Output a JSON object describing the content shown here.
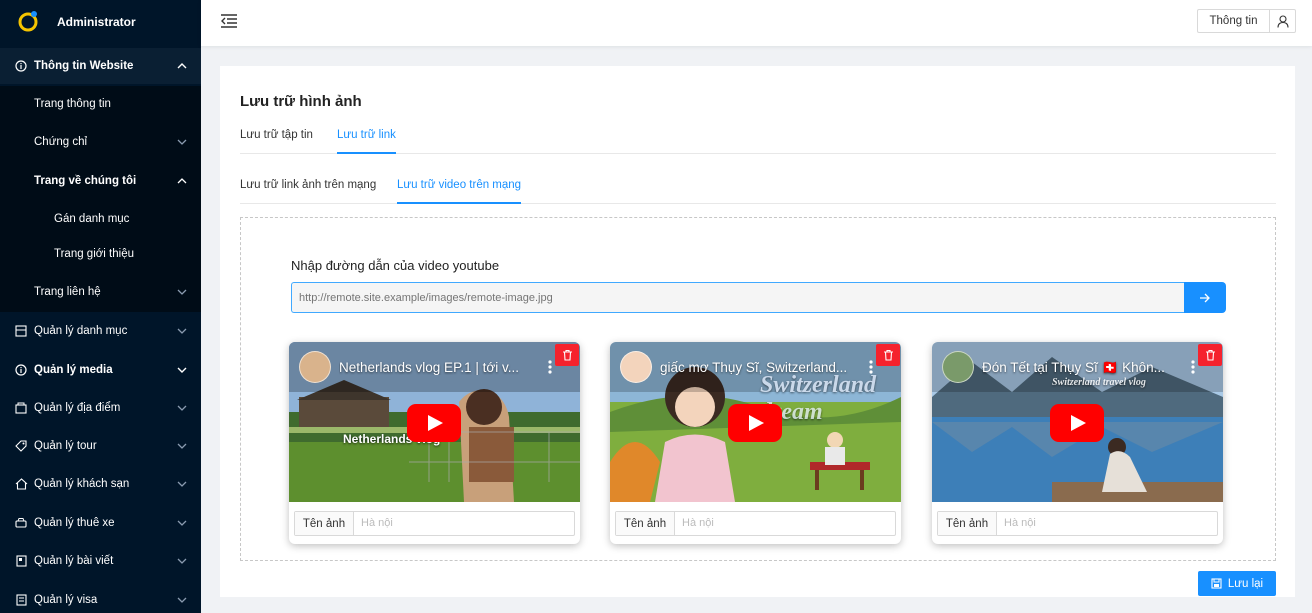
{
  "sidebar": {
    "brand": "Administrator",
    "items": [
      {
        "label": "Thông tin Website",
        "icon": "info-icon",
        "arrow": "up"
      },
      {
        "label": "Quản lý danh mục",
        "icon": "list-icon",
        "arrow": "down"
      },
      {
        "label": "Quản lý media",
        "icon": "info-icon",
        "arrow": "down"
      },
      {
        "label": "Quản lý địa điểm",
        "icon": "map-pin-icon",
        "arrow": "down"
      },
      {
        "label": "Quản lý tour",
        "icon": "tag-icon",
        "arrow": "down"
      },
      {
        "label": "Quản lý khách sạn",
        "icon": "home-icon",
        "arrow": "down"
      },
      {
        "label": "Quản lý thuê xe",
        "icon": "car-icon",
        "arrow": "down"
      },
      {
        "label": "Quản lý bài viết",
        "icon": "file-icon",
        "arrow": "down"
      },
      {
        "label": "Quản lý visa",
        "icon": "document-icon",
        "arrow": "down"
      }
    ],
    "submenu": [
      {
        "label": "Trang thông tin"
      },
      {
        "label": "Chứng chỉ",
        "arrow": "down"
      },
      {
        "label": "Trang về chúng tôi",
        "arrow": "up"
      },
      {
        "label": "Gán danh mục"
      },
      {
        "label": "Trang giới thiệu"
      },
      {
        "label": "Trang liên hệ",
        "arrow": "down"
      }
    ]
  },
  "header": {
    "info_button": "Thông tin",
    "menu_toggle_icon": "menu-fold-icon",
    "user_icon": "user-icon"
  },
  "main": {
    "title": "Lưu trữ hình ảnh",
    "tabs": [
      {
        "label": "Lưu trữ tập tin",
        "active": false
      },
      {
        "label": "Lưu trữ link",
        "active": true
      }
    ],
    "subtabs": [
      {
        "label": "Lưu trữ link ảnh trên mạng",
        "active": false
      },
      {
        "label": "Lưu trữ video trên mạng",
        "active": true
      }
    ],
    "youtube_label": "Nhập đường dẫn của video youtube",
    "url_placeholder": "http://remote.site.example/images/remote-image.jpg",
    "videos": [
      {
        "title": "Netherlands vlog EP.1 | tới v...",
        "caption": "Netherlands vlog",
        "name_label": "Tên ảnh",
        "name_placeholder": "Hà nội"
      },
      {
        "title": "giấc mơ Thụy Sĩ, Switzerland...",
        "caption": "Switzerland dream",
        "name_label": "Tên ảnh",
        "name_placeholder": "Hà nội"
      },
      {
        "title": "Đón Tết tại Thụy Sĩ 🇨🇭 Khôn...",
        "caption": "Switzerland travel vlog",
        "name_label": "Tên ảnh",
        "name_placeholder": "Hà nội"
      }
    ],
    "save_label": "Lưu lại"
  },
  "colors": {
    "sidebar_bg": "#001529",
    "accent": "#1890ff",
    "danger": "#f5222d",
    "youtube_red": "#ff0000"
  }
}
